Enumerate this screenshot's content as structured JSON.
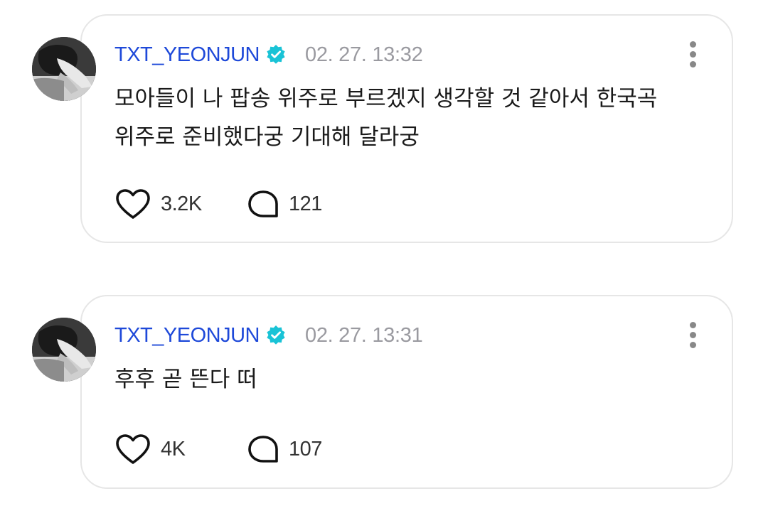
{
  "posts": [
    {
      "username": "TXT_YEONJUN",
      "verified_icon": "verified-badge-icon",
      "timestamp": "02. 27. 13:32",
      "text": "모아들이 나 팝송 위주로 부르겠지 생각할 것 같아서 한국곡\n위주로 준비했다궁 기대해 달라궁",
      "likes": "3.2K",
      "comments": "121"
    },
    {
      "username": "TXT_YEONJUN",
      "verified_icon": "verified-badge-icon",
      "timestamp": "02. 27. 13:31",
      "text": "후후 곧 뜬다 떠",
      "likes": "4K",
      "comments": "107"
    }
  ],
  "colors": {
    "username": "#1e49d9",
    "verified": "#19c3d6",
    "timestamp": "#9a9aa0",
    "text": "#1a1a1a",
    "card_border": "#e6e6e6",
    "icon": "#111111"
  },
  "icons": {
    "like": "heart-outline-icon",
    "comment": "speech-bubble-outline-icon",
    "more": "vertical-ellipsis-icon",
    "avatar": "profile-photo-avatar"
  }
}
